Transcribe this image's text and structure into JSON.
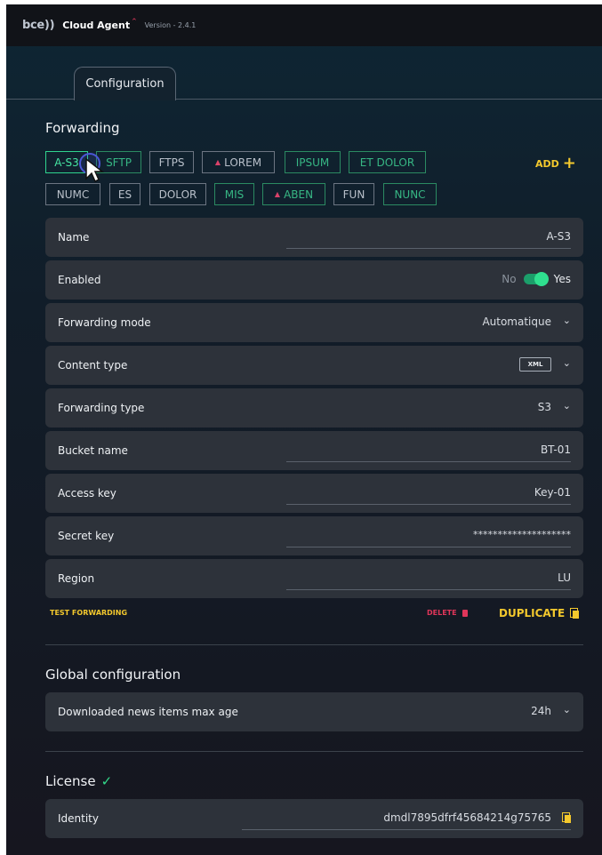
{
  "titlebar": {
    "logo": "bce))",
    "app_name": "Cloud Agent",
    "version": "Version - 2.4.1"
  },
  "tabs": [
    {
      "label": "Configuration"
    }
  ],
  "forwarding": {
    "title": "Forwarding",
    "add_label": "ADD",
    "chips_row1": [
      "A-S3",
      "SFTP",
      "FTPS",
      "LOREM",
      "IPSUM",
      "ET DOLOR"
    ],
    "chips_row2": [
      "NUMC",
      "ES",
      "DOLOR",
      "MIS",
      "ABEN",
      "FUN",
      "NUNC"
    ],
    "fields": {
      "name": {
        "label": "Name",
        "value": "A-S3"
      },
      "enabled": {
        "label": "Enabled",
        "off_label": "No",
        "on_label": "Yes",
        "value": true
      },
      "forwarding_mode": {
        "label": "Forwarding mode",
        "value": "Automatique"
      },
      "content_type": {
        "label": "Content type",
        "value": "XML"
      },
      "forwarding_type": {
        "label": "Forwarding type",
        "value": "S3"
      },
      "bucket_name": {
        "label": "Bucket name",
        "value": "BT-01"
      },
      "access_key": {
        "label": "Access key",
        "value": "Key-01"
      },
      "secret_key": {
        "label": "Secret key",
        "value": "********************"
      },
      "region": {
        "label": "Region",
        "value": "LU"
      }
    },
    "test_label": "TEST FORWARDING",
    "delete_label": "DELETE",
    "duplicate_label": "DUPLICATE"
  },
  "global": {
    "title": "Global configuration",
    "max_age": {
      "label": "Downloaded news items max age",
      "value": "24h"
    }
  },
  "license": {
    "title": "License",
    "identity": {
      "label": "Identity",
      "value": "dmdl7895dfrf45684214g75765"
    }
  },
  "colors": {
    "accent_yellow": "#f3c82d",
    "accent_green": "#2fd38e",
    "danger": "#e0365a"
  }
}
